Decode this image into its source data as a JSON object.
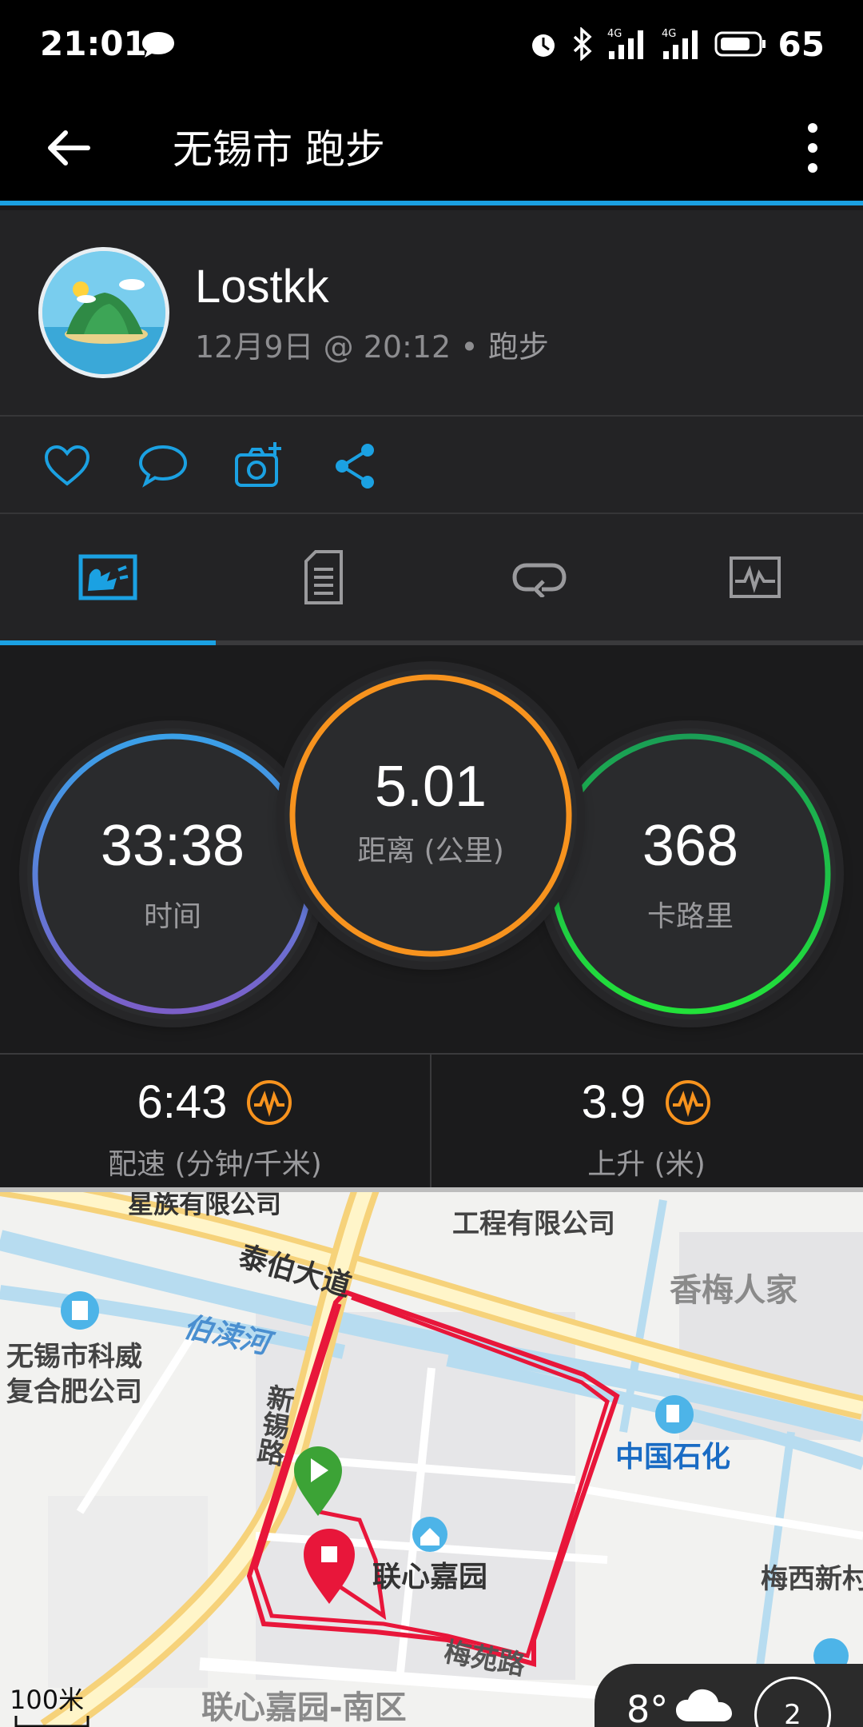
{
  "status_bar": {
    "time": "21:01",
    "battery": "65",
    "net1": "4G",
    "net2": "4G"
  },
  "header": {
    "title": "无锡市 跑步"
  },
  "profile": {
    "name": "Lostkk",
    "date": "12月9日 @ 20:12",
    "separator": "•",
    "activity": "跑步"
  },
  "stats": {
    "time": {
      "value": "33:38",
      "label": "时间",
      "color_top": "#3aa0e8",
      "color_bottom": "#7b5fc9"
    },
    "distance": {
      "value": "5.01",
      "label": "距离 (公里)",
      "color": "#f7931e"
    },
    "calories": {
      "value": "368",
      "label": "卡路里",
      "color": "#1fd24a"
    }
  },
  "secondary": {
    "pace": {
      "value": "6:43",
      "label": "配速 (分钟/千米)"
    },
    "ascent": {
      "value": "3.9",
      "label": "上升 (米)"
    }
  },
  "map": {
    "labels": {
      "company_top": "星族有限公司",
      "engineering": "工程有限公司",
      "road_taibo": "泰伯大道",
      "xiangmei": "香梅人家",
      "river": "伯渎河",
      "kewei1": "无锡市科威",
      "kewei2": "复合肥公司",
      "xinjing": "新锡路",
      "sinopec": "中国石化",
      "lianxin": "联心嘉园",
      "meixi": "梅西新村",
      "meiyuan": "梅苑路",
      "lianxin_south": "联心嘉园-南区",
      "scale": "100米"
    },
    "weather_temp": "8°",
    "compass": "2"
  },
  "colors": {
    "accent": "#1ba1e2",
    "route": "#e8163a",
    "icon_orange": "#f7931e"
  }
}
